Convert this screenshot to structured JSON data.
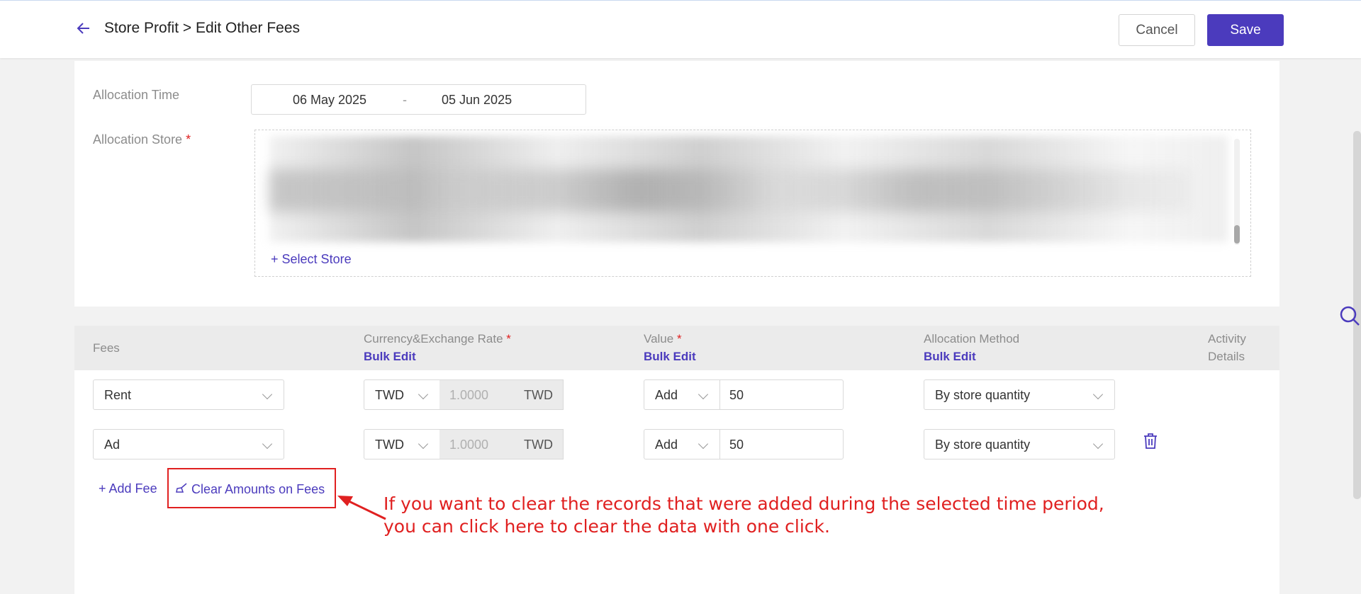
{
  "header": {
    "back_icon": "arrow-left-icon",
    "breadcrumb": "Store Profit > Edit Other Fees",
    "cancel_label": "Cancel",
    "save_label": "Save"
  },
  "allocation": {
    "time_label": "Allocation Time",
    "date_start": "06 May 2025",
    "date_separator": "-",
    "date_end": "05 Jun 2025",
    "store_label": "Allocation Store",
    "required_mark": "*",
    "select_store_label": "Select Store"
  },
  "table": {
    "headers": {
      "fees": "Fees",
      "currency": "Currency&Exchange Rate",
      "value": "Value",
      "method": "Allocation Method",
      "activity_line1": "Activity",
      "activity_line2": "Details"
    },
    "bulk_edit": "Bulk Edit",
    "required_mark": "*",
    "rows": [
      {
        "fee": "Rent",
        "currency": "TWD",
        "rate": "1.0000",
        "rate_currency": "TWD",
        "op": "Add",
        "value": "50",
        "method": "By store quantity"
      },
      {
        "fee": "Ad",
        "currency": "TWD",
        "rate": "1.0000",
        "rate_currency": "TWD",
        "op": "Add",
        "value": "50",
        "method": "By store quantity"
      }
    ],
    "add_fee_label": "Add Fee",
    "clear_label": "Clear Amounts on Fees"
  },
  "callout": {
    "line1": "If you want to clear the records that were added during the selected time period,",
    "line2": "you can click here to clear the data with one click."
  },
  "colors": {
    "accent": "#4b3bbd",
    "annotation": "#e02020"
  }
}
